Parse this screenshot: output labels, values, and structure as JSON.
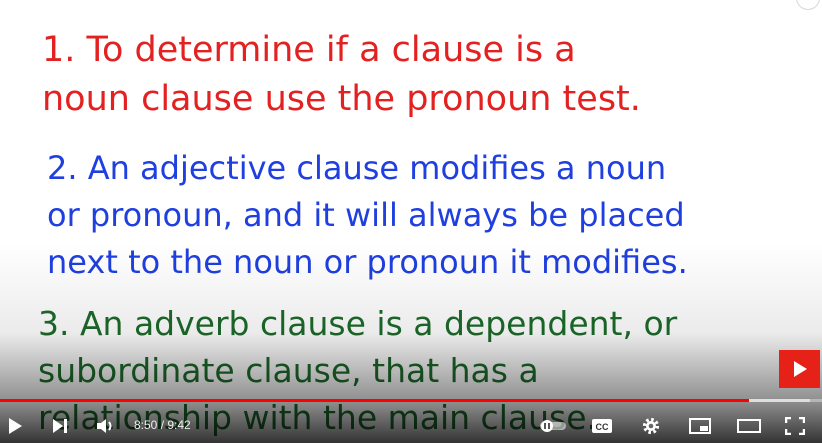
{
  "slide": {
    "point1": [
      "1. To determine if a clause is a",
      "noun clause use the pronoun test."
    ],
    "point2": [
      "2. An adjective clause modifies a noun",
      "or pronoun, and it will always be placed",
      "next to the noun or pronoun it modifies."
    ],
    "point3": [
      "3. An adverb clause is a dependent, or",
      "subordinate clause, that has a",
      "relationship with the main clause."
    ]
  },
  "player": {
    "current_time": "8:50",
    "time_separator": " / ",
    "duration": "9:42",
    "progress_fraction": 0.9107,
    "buffered_fraction": 0.985,
    "cc_label": "CC",
    "colors": {
      "played": "#ff0000",
      "next_button": "#e62117",
      "point1": "#e32121",
      "point2": "#1f3fe0",
      "point3": "#1c6b2a"
    },
    "icons": [
      "play-icon",
      "next-icon",
      "volume-icon",
      "autoplay-toggle-icon",
      "cc-icon",
      "gear-icon",
      "miniplayer-icon",
      "theater-icon",
      "fullscreen-icon"
    ]
  }
}
